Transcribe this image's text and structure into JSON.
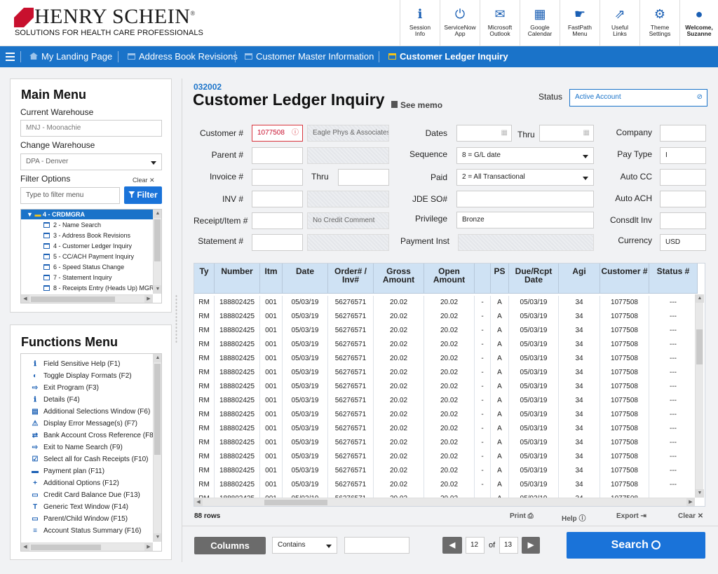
{
  "brand": {
    "name": "HENRY SCHEIN",
    "reg": "®",
    "tagline": "SOLUTIONS FOR HEALTH CARE PROFESSIONALS"
  },
  "toolbar": [
    {
      "label": "Session\nInfo",
      "icon": "info-icon"
    },
    {
      "label": "ServiceNow\nApp",
      "icon": "power-icon"
    },
    {
      "label": "Microsoft\nOutlook",
      "icon": "mail-icon"
    },
    {
      "label": "Google\nCalendar",
      "icon": "calendar-icon"
    },
    {
      "label": "FastPath\nMenu",
      "icon": "hand-icon"
    },
    {
      "label": "Useful\nLinks",
      "icon": "external-link-icon"
    },
    {
      "label": "Theme\nSettings",
      "icon": "gears-icon"
    },
    {
      "label": "Welcome,\nSuzanne",
      "icon": "user-icon"
    }
  ],
  "nav": {
    "items": [
      "My Landing Page",
      "Address Book Revisions",
      "Customer Master Information",
      "Customer Ledger Inquiry"
    ],
    "active_index": 3
  },
  "main_menu": {
    "title": "Main Menu",
    "current_warehouse_label": "Current Warehouse",
    "current_warehouse_value": "MNJ - Moonachie",
    "change_warehouse_label": "Change Warehouse",
    "change_warehouse_value": "DPA - Denver",
    "filter_label": "Filter Options",
    "clear_label": "Clear",
    "filter_placeholder": "Type to filter menu",
    "filter_button": "Filter",
    "tree_root": "4 - CRDMGRA",
    "tree_items": [
      "2 - Name Search",
      "3 - Address Book Revisions",
      "4 - Customer Ledger Inquiry",
      "5 - CC/ACH Payment Inquiry",
      "6 - Speed Status Change",
      "7 - Statement Inquiry",
      "8 - Receipts Entry (Heads Up) MGR"
    ]
  },
  "functions_menu": {
    "title": "Functions Menu",
    "items": [
      {
        "label": "Field Sensitive Help (F1)",
        "icon": "info-circle-icon"
      },
      {
        "label": "Toggle Display Formats (F2)",
        "icon": "toggle-icon"
      },
      {
        "label": "Exit Program (F3)",
        "icon": "exit-icon"
      },
      {
        "label": "Details (F4)",
        "icon": "info-square-icon"
      },
      {
        "label": "Additional Selections Window (F6)",
        "icon": "list-icon"
      },
      {
        "label": "Display Error Message(s) (F7)",
        "icon": "warning-icon"
      },
      {
        "label": "Bank Account Cross Reference (F8)",
        "icon": "exchange-icon"
      },
      {
        "label": "Exit to Name Search (F9)",
        "icon": "exit-icon"
      },
      {
        "label": "Select all for Cash Receipts (F10)",
        "icon": "check-square-icon"
      },
      {
        "label": "Payment plan (F11)",
        "icon": "money-icon"
      },
      {
        "label": "Additional Options (F12)",
        "icon": "plus-icon"
      },
      {
        "label": "Credit Card Balance Due (F13)",
        "icon": "credit-card-icon"
      },
      {
        "label": "Generic Text Window (F14)",
        "icon": "text-icon"
      },
      {
        "label": "Parent/Child Window (F15)",
        "icon": "window-icon"
      },
      {
        "label": "Account Status Summary (F16)",
        "icon": "list-lines-icon"
      }
    ]
  },
  "page": {
    "code": "032002",
    "title": "Customer Ledger Inquiry",
    "see_memo": "See memo",
    "status_label": "Status",
    "status_value": "Active Account"
  },
  "form": {
    "customer_label": "Customer #",
    "customer_value": "1077508",
    "customer_name": "Eagle Phys & Associates",
    "parent_label": "Parent #",
    "invoice_label": "Invoice #",
    "thru_label": "Thru",
    "inv_label": "INV #",
    "receipt_label": "Receipt/Item #",
    "credit_comment": "No Credit Comment",
    "statement_label": "Statement #",
    "dates_label": "Dates",
    "dates_thru_label": "Thru",
    "sequence_label": "Sequence",
    "sequence_value": "8 = G/L date",
    "paid_label": "Paid",
    "paid_value": "2 = All Transactional",
    "jde_label": "JDE SO#",
    "privilege_label": "Privilege",
    "privilege_value": "Bronze",
    "payment_inst_label": "Payment Inst",
    "company_label": "Company",
    "pay_type_label": "Pay Type",
    "pay_type_value": "I",
    "auto_cc_label": "Auto CC",
    "auto_ach_label": "Auto ACH",
    "consdlt_label": "Consdlt Inv",
    "currency_label": "Currency",
    "currency_value": "USD"
  },
  "grid": {
    "columns": [
      "Ty",
      "Number",
      "Itm",
      "Date",
      "Order# / Inv#",
      "Gross Amount",
      "Open Amount",
      "",
      "PS",
      "Due/Rcpt Date",
      "Agi",
      "Customer #",
      "Status #"
    ],
    "rows": [
      [
        "RM",
        "188802425",
        "001",
        "05/03/19",
        "56276571",
        "20.02",
        "20.02",
        "-",
        "A",
        "05/03/19",
        "34",
        "1077508",
        "---"
      ],
      [
        "RM",
        "188802425",
        "001",
        "05/03/19",
        "56276571",
        "20.02",
        "20.02",
        "-",
        "A",
        "05/03/19",
        "34",
        "1077508",
        "---"
      ],
      [
        "RM",
        "188802425",
        "001",
        "05/03/19",
        "56276571",
        "20.02",
        "20.02",
        "-",
        "A",
        "05/03/19",
        "34",
        "1077508",
        "---"
      ],
      [
        "RM",
        "188802425",
        "001",
        "05/03/19",
        "56276571",
        "20.02",
        "20.02",
        "-",
        "A",
        "05/03/19",
        "34",
        "1077508",
        "---"
      ],
      [
        "RM",
        "188802425",
        "001",
        "05/03/19",
        "56276571",
        "20.02",
        "20.02",
        "-",
        "A",
        "05/03/19",
        "34",
        "1077508",
        "---"
      ],
      [
        "RM",
        "188802425",
        "001",
        "05/03/19",
        "56276571",
        "20.02",
        "20.02",
        "-",
        "A",
        "05/03/19",
        "34",
        "1077508",
        "---"
      ],
      [
        "RM",
        "188802425",
        "001",
        "05/03/19",
        "56276571",
        "20.02",
        "20.02",
        "-",
        "A",
        "05/03/19",
        "34",
        "1077508",
        "---"
      ],
      [
        "RM",
        "188802425",
        "001",
        "05/03/19",
        "56276571",
        "20.02",
        "20.02",
        "-",
        "A",
        "05/03/19",
        "34",
        "1077508",
        "---"
      ],
      [
        "RM",
        "188802425",
        "001",
        "05/03/19",
        "56276571",
        "20.02",
        "20.02",
        "-",
        "A",
        "05/03/19",
        "34",
        "1077508",
        "---"
      ],
      [
        "RM",
        "188802425",
        "001",
        "05/03/19",
        "56276571",
        "20.02",
        "20.02",
        "-",
        "A",
        "05/03/19",
        "34",
        "1077508",
        "---"
      ],
      [
        "RM",
        "188802425",
        "001",
        "05/03/19",
        "56276571",
        "20.02",
        "20.02",
        "-",
        "A",
        "05/03/19",
        "34",
        "1077508",
        "---"
      ],
      [
        "RM",
        "188802425",
        "001",
        "05/03/19",
        "56276571",
        "20.02",
        "20.02",
        "-",
        "A",
        "05/03/19",
        "34",
        "1077508",
        "---"
      ],
      [
        "RM",
        "188802425",
        "001",
        "05/03/19",
        "56276571",
        "20.02",
        "20.02",
        "-",
        "A",
        "05/03/19",
        "34",
        "1077508",
        "---"
      ],
      [
        "RM",
        "188802425",
        "001",
        "05/03/19",
        "56276571",
        "20.02",
        "20.02",
        "-",
        "A",
        "05/03/19",
        "34",
        "1077508",
        "---"
      ],
      [
        "RM",
        "188802425",
        "001",
        "05/03/19",
        "56276571",
        "20.02",
        "20.02",
        "-",
        "A",
        "05/03/19",
        "34",
        "1077508",
        "---"
      ]
    ],
    "row_count": "88 rows"
  },
  "actions": {
    "print": "Print",
    "help": "Help",
    "export": "Export",
    "clear": "Clear"
  },
  "footer": {
    "columns_button": "Columns",
    "contains_value": "Contains",
    "page_current": "12",
    "of_label": "of",
    "page_total": "13",
    "search_button": "Search"
  },
  "colors": {
    "brand_red": "#c8102e",
    "nav_blue": "#1a73c9",
    "accent_blue": "#1a5fb4",
    "header_blue": "#cfe2f4"
  }
}
